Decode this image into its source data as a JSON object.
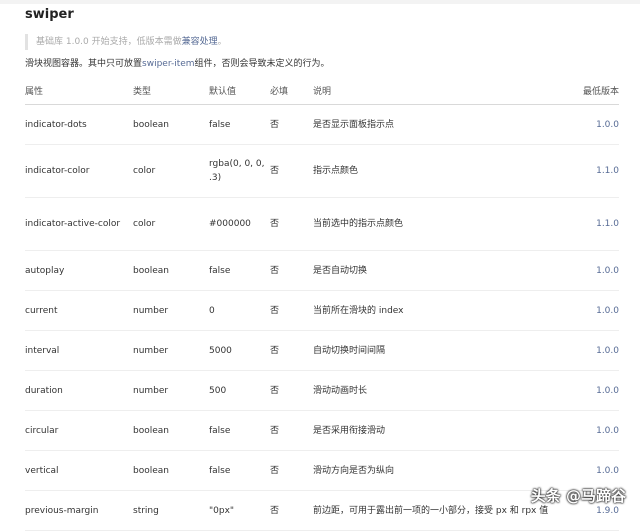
{
  "title": "swiper",
  "note": {
    "text": "基础库 1.0.0 开始支持，低版本需做",
    "link": "兼容处理",
    "suffix": "。"
  },
  "description": {
    "prefix": "滑块视图容器。其中只可放置",
    "link": "swiper-item",
    "suffix": "组件，否则会导致未定义的行为。"
  },
  "columns": [
    "属性",
    "类型",
    "默认值",
    "必填",
    "说明",
    "最低版本"
  ],
  "rows": [
    {
      "attr": "indicator-dots",
      "type": "boolean",
      "default": "false",
      "required": "否",
      "desc": "是否显示面板指示点",
      "version": "1.0.0"
    },
    {
      "attr": "indicator-color",
      "type": "color",
      "default": "rgba(0, 0, 0, .3)",
      "required": "否",
      "desc": "指示点颜色",
      "version": "1.1.0"
    },
    {
      "attr": "indicator-active-color",
      "type": "color",
      "default": "#000000",
      "required": "否",
      "desc": "当前选中的指示点颜色",
      "version": "1.1.0"
    },
    {
      "attr": "autoplay",
      "type": "boolean",
      "default": "false",
      "required": "否",
      "desc": "是否自动切换",
      "version": "1.0.0"
    },
    {
      "attr": "current",
      "type": "number",
      "default": "0",
      "required": "否",
      "desc": "当前所在滑块的 index",
      "version": "1.0.0"
    },
    {
      "attr": "interval",
      "type": "number",
      "default": "5000",
      "required": "否",
      "desc": "自动切换时间间隔",
      "version": "1.0.0"
    },
    {
      "attr": "duration",
      "type": "number",
      "default": "500",
      "required": "否",
      "desc": "滑动动画时长",
      "version": "1.0.0"
    },
    {
      "attr": "circular",
      "type": "boolean",
      "default": "false",
      "required": "否",
      "desc": "是否采用衔接滑动",
      "version": "1.0.0"
    },
    {
      "attr": "vertical",
      "type": "boolean",
      "default": "false",
      "required": "否",
      "desc": "滑动方向是否为纵向",
      "version": "1.0.0"
    },
    {
      "attr": "previous-margin",
      "type": "string",
      "default": "\"0px\"",
      "required": "否",
      "desc": "前边距，可用于露出前一项的一小部分，接受 px 和 rpx 值",
      "version": "1.9.0"
    }
  ],
  "watermark": "头条 @马蹄谷"
}
